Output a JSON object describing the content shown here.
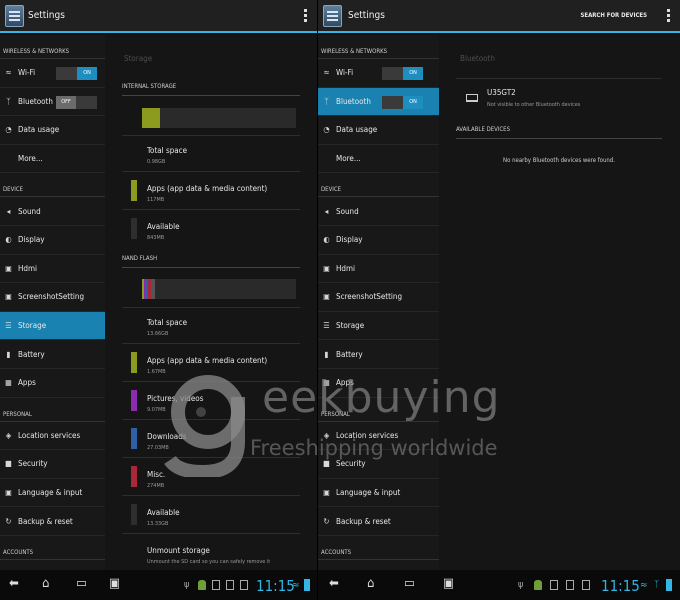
{
  "left": {
    "title": "Settings",
    "sidebar": {
      "wireless_header": "WIRELESS & NETWORKS",
      "wifi": "Wi-Fi",
      "wifi_toggle": "ON",
      "bluetooth": "Bluetooth",
      "bluetooth_toggle": "OFF",
      "data_usage": "Data usage",
      "more": "More...",
      "device_header": "DEVICE",
      "sound": "Sound",
      "display": "Display",
      "hdmi": "Hdmi",
      "screenshot": "ScreenshotSetting",
      "storage": "Storage",
      "battery": "Battery",
      "apps": "Apps",
      "personal_header": "PERSONAL",
      "location": "Location services",
      "security": "Security",
      "language": "Language & input",
      "backup": "Backup & reset",
      "accounts_header": "ACCOUNTS"
    },
    "content": {
      "title": "Storage",
      "internal_header": "INTERNAL STORAGE",
      "internal_total_label": "Total space",
      "internal_total_value": "0.98GB",
      "internal_apps_label": "Apps (app data & media content)",
      "internal_apps_value": "117MB",
      "internal_available_label": "Available",
      "internal_available_value": "843MB",
      "nand_header": "NAND FLASH",
      "nand_total_label": "Total space",
      "nand_total_value": "13.66GB",
      "nand_apps_label": "Apps (app data & media content)",
      "nand_apps_value": "1.67MB",
      "pictures_label": "Pictures, videos",
      "pictures_value": "9.07MB",
      "downloads_label": "Downloads",
      "downloads_value": "27.03MB",
      "misc_label": "Misc.",
      "misc_value": "274MB",
      "nand_available_label": "Available",
      "nand_available_value": "13.33GB",
      "unmount_label": "Unmount storage",
      "unmount_desc": "Unmount the SD card so you can safely remove it",
      "internal_used_fraction": 0.12
    },
    "time": "11:15"
  },
  "right": {
    "title": "Settings",
    "action": "SEARCH FOR DEVICES",
    "content": {
      "title": "Bluetooth",
      "device_name": "U35GT2",
      "device_status": "Not visible to other Bluetooth devices",
      "available_header": "AVAILABLE DEVICES",
      "no_devices": "No nearby Bluetooth devices were found."
    },
    "wifi_toggle": "ON",
    "bluetooth_toggle": "ON",
    "time": "11:15"
  },
  "watermark": {
    "brand_tail": "eekbuying",
    "tagline": "Freeshipping worldwide"
  },
  "colors": {
    "accent": "#33b5e5",
    "active_item": "#1a82b0",
    "apps_swatch": "#8c9a1d",
    "pictures_swatch": "#8a2bb0",
    "downloads_swatch": "#2e5fa8",
    "misc_swatch": "#a8283a",
    "available_swatch": "#2e2e2e"
  }
}
